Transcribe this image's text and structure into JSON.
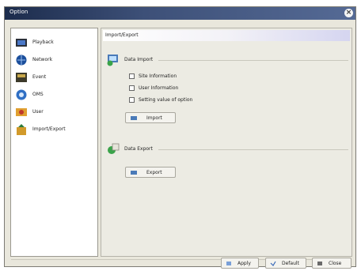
{
  "window": {
    "title": "Option"
  },
  "sidebar": {
    "items": [
      {
        "label": "Playback",
        "icon": "playback-icon"
      },
      {
        "label": "Network",
        "icon": "network-icon"
      },
      {
        "label": "Event",
        "icon": "event-icon"
      },
      {
        "label": "OMS",
        "icon": "oms-icon"
      },
      {
        "label": "User",
        "icon": "user-icon"
      },
      {
        "label": "Import/Export",
        "icon": "import-export-icon"
      }
    ]
  },
  "main": {
    "header": "Import/Export",
    "data_import": {
      "title": "Data Import",
      "options": [
        {
          "label": "Site Information",
          "checked": false
        },
        {
          "label": "User Information",
          "checked": false
        },
        {
          "label": "Setting value of option",
          "checked": false
        }
      ],
      "button": "Import"
    },
    "data_export": {
      "title": "Data Export",
      "button": "Export"
    }
  },
  "footer": {
    "apply": "Apply",
    "default": "Default",
    "close": "Close"
  },
  "colors": {
    "titlebar": "#1c2c4c",
    "panel": "#e9e7dc"
  }
}
